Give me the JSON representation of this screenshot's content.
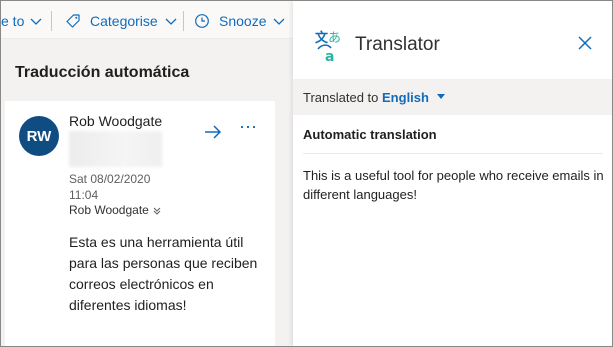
{
  "toolbar": {
    "move_label": "e to",
    "categorise_label": "Categorise",
    "snooze_label": "Snooze"
  },
  "email": {
    "subject": "Traducción automática",
    "avatar_initials": "RW",
    "sender": "Rob Woodgate",
    "date": "Sat 08/02/2020",
    "time": "11:04",
    "to": "Rob Woodgate",
    "body": "Esta es una herramienta útil para las personas que reciben correos electrónicos en diferentes idiomas!",
    "avatar_color": "#0f4c81"
  },
  "translator": {
    "title": "Translator",
    "translated_to_label": "Translated to",
    "language": "English",
    "section_heading": "Automatic translation",
    "translation_text": "This is a useful tool for people who receive emails in different languages!"
  },
  "colors": {
    "accent": "#0f6cbd",
    "pane_bg": "#f3f2f1"
  },
  "icons": [
    "tag-icon",
    "clock-icon",
    "chevron-down-icon",
    "forward-arrow-icon",
    "more-icon",
    "translator-logo-icon",
    "close-icon",
    "caret-down-icon"
  ]
}
